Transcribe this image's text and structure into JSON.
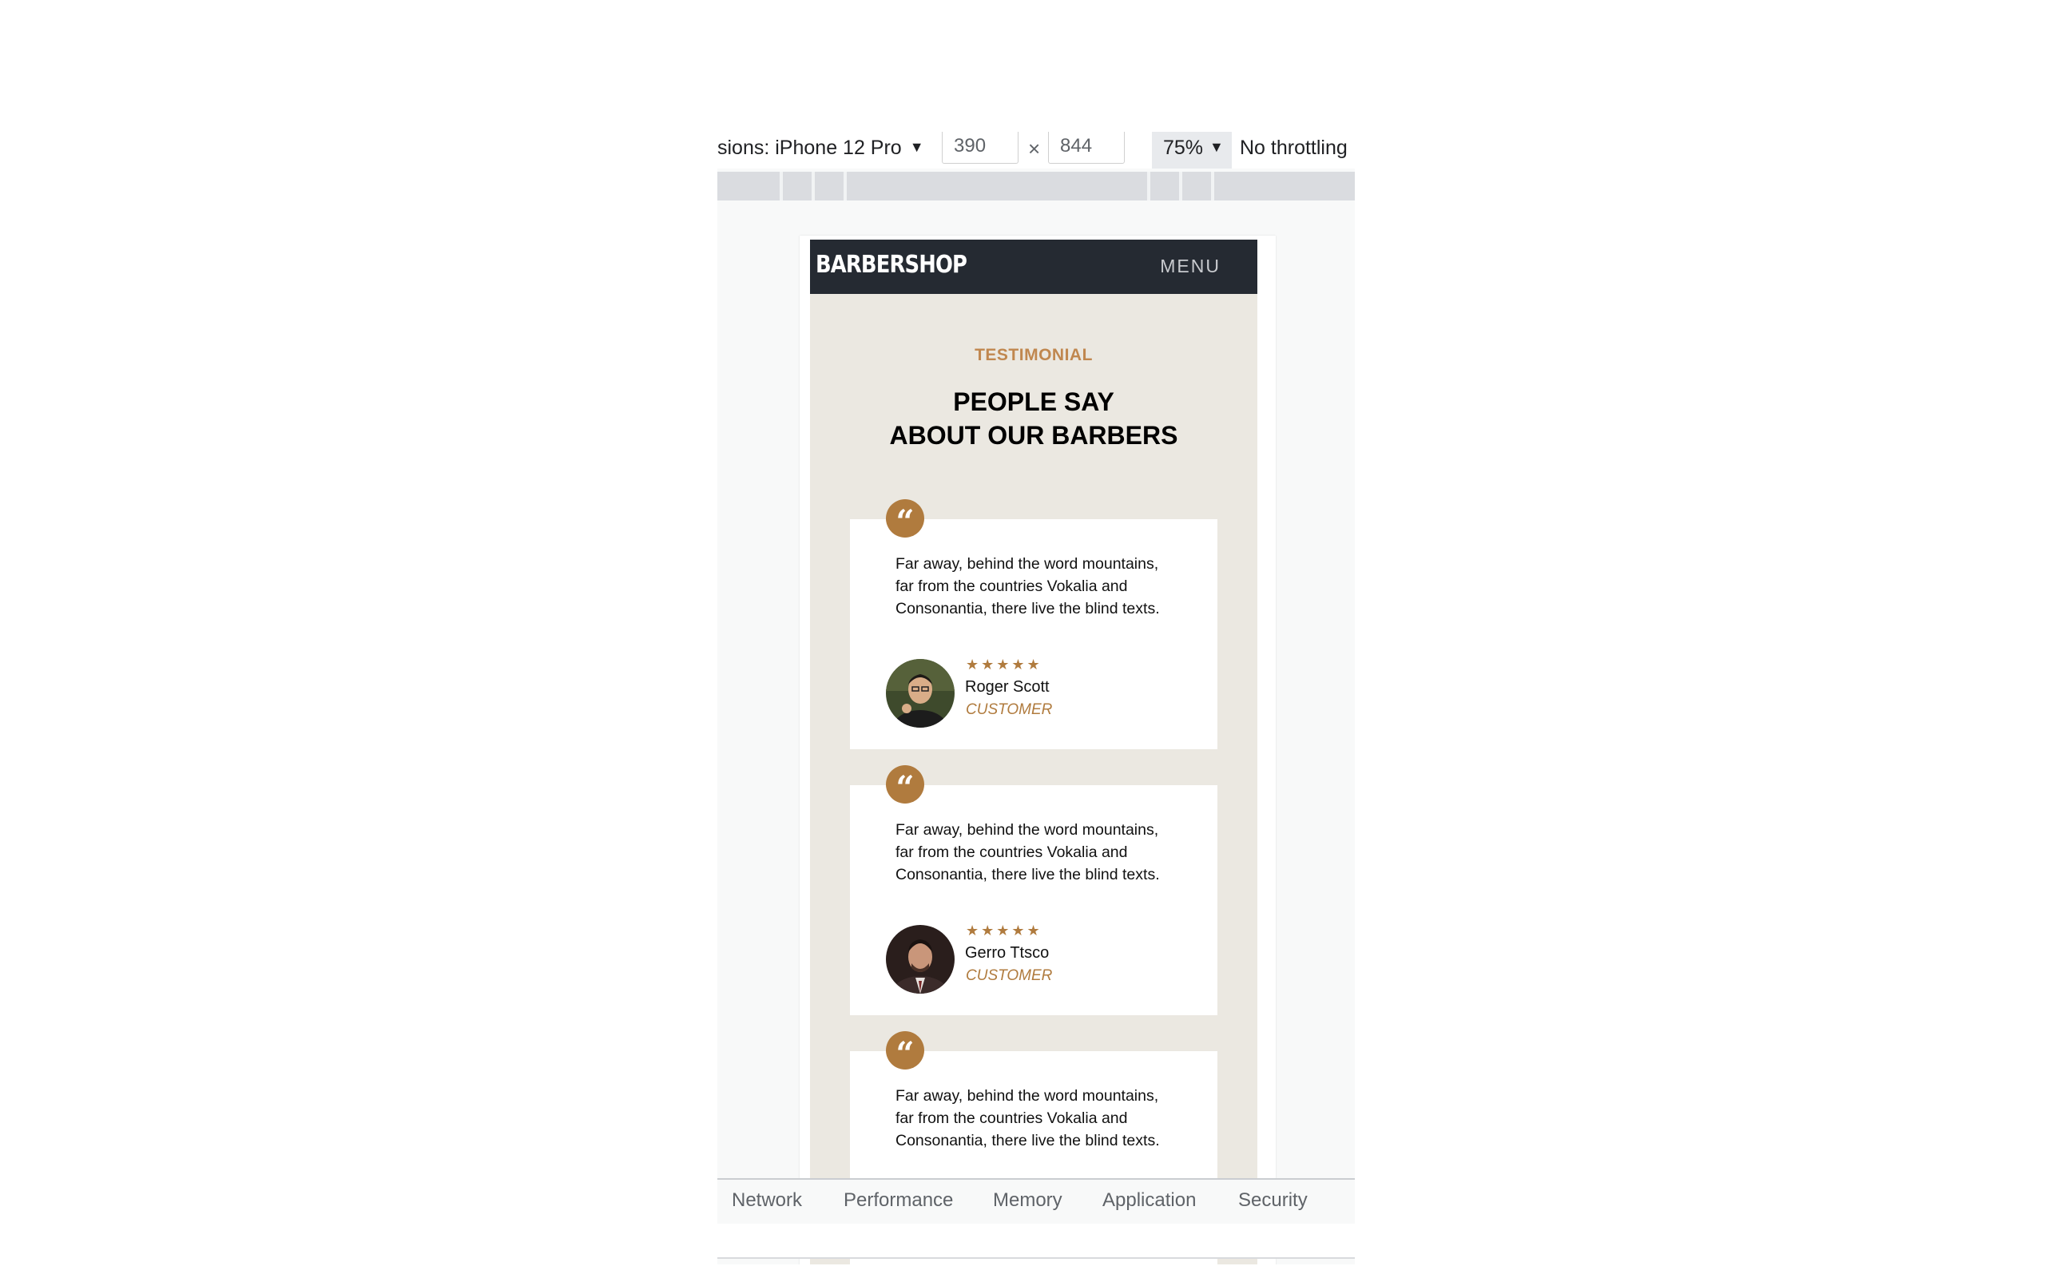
{
  "device_toolbar": {
    "dimensions_label": "sions: iPhone 12 Pro",
    "width_value": "390",
    "height_value": "844",
    "times_symbol": "×",
    "zoom": "75%",
    "throttling": "No throttling"
  },
  "site": {
    "brand": "BARBERSHOP",
    "menu": "MENU",
    "eyebrow": "TESTIMONIAL",
    "title_line1": "PEOPLE SAY",
    "title_line2": "ABOUT OUR BARBERS",
    "testimonials": [
      {
        "text": "Far away, behind the word mountains, far from the countries Vokalia and Consonantia, there live the blind texts.",
        "rating": 5,
        "stars": "★★★★★",
        "name": "Roger Scott",
        "role": "CUSTOMER"
      },
      {
        "text": "Far away, behind the word mountains, far from the countries Vokalia and Consonantia, there live the blind texts.",
        "rating": 5,
        "stars": "★★★★★",
        "name": "Gerro Ttsco",
        "role": "CUSTOMER"
      },
      {
        "text": "Far away, behind the word mountains, far from the countries Vokalia and Consonantia, there live the blind texts."
      }
    ]
  },
  "devtools_tabs": [
    "Network",
    "Performance",
    "Memory",
    "Application",
    "Security"
  ],
  "colors": {
    "accent": "#b07b3e",
    "eyebrow": "#c0874f",
    "navbar": "#252a32",
    "page_bg": "#ebe8e1"
  }
}
